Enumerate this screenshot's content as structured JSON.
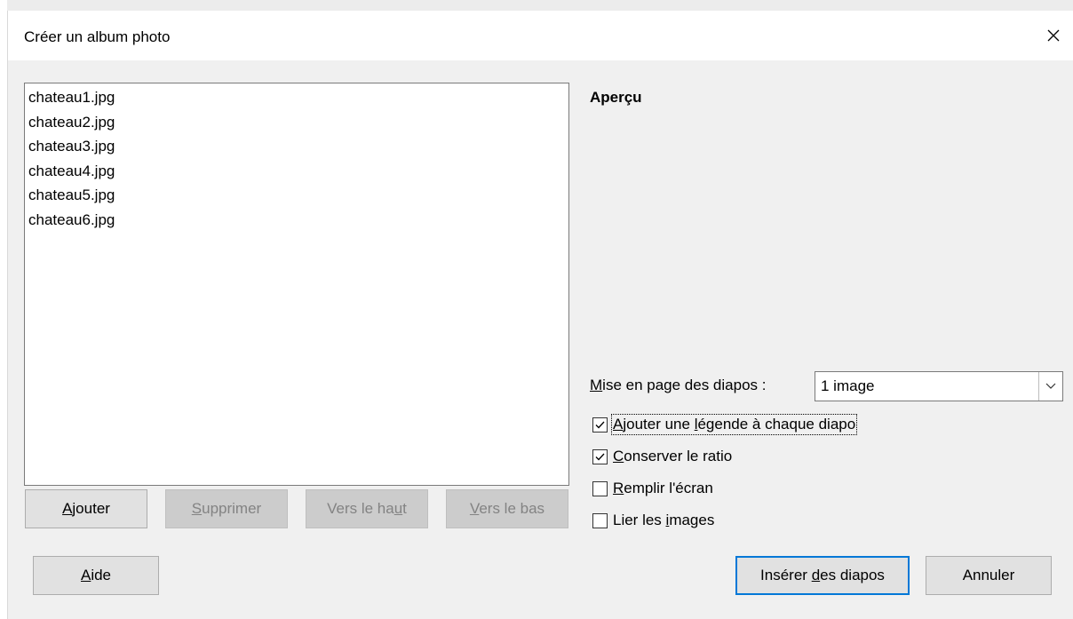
{
  "dialog": {
    "title": "Créer un album photo",
    "close_glyph": "✕"
  },
  "files": [
    "chateau1.jpg",
    "chateau2.jpg",
    "chateau3.jpg",
    "chateau4.jpg",
    "chateau5.jpg",
    "chateau6.jpg"
  ],
  "list_buttons": {
    "add": {
      "pre": "",
      "key": "A",
      "post": "jouter"
    },
    "remove": {
      "pre": "",
      "key": "S",
      "post": "upprimer"
    },
    "up": {
      "pre": "Vers le ha",
      "key": "u",
      "post": "t"
    },
    "down": {
      "pre": "",
      "key": "V",
      "post": "ers le bas"
    }
  },
  "preview": {
    "label": "Aperçu"
  },
  "layout": {
    "label_key": "M",
    "label_rest": "ise en page des diapos :",
    "value": "1 image",
    "options": [
      "1 image"
    ]
  },
  "options": [
    {
      "pre": "",
      "key": "A",
      "post": "jouter une ",
      "key2": "l",
      "post2": "égende à chaque diapo",
      "checked": true
    },
    {
      "pre": "",
      "key": "C",
      "post": "onserver le ratio",
      "key2": "",
      "post2": "",
      "checked": true
    },
    {
      "pre": "",
      "key": "R",
      "post": "emplir l'écran",
      "key2": "",
      "post2": "",
      "checked": false
    },
    {
      "pre": "Lier les ",
      "key": "i",
      "post": "mages",
      "key2": "",
      "post2": "",
      "checked": false
    }
  ],
  "footer": {
    "help": {
      "pre": "",
      "key": "A",
      "post": "ide"
    },
    "insert": {
      "pre": "Insérer ",
      "key": "d",
      "post": "es diapos"
    },
    "cancel": "Annuler"
  }
}
